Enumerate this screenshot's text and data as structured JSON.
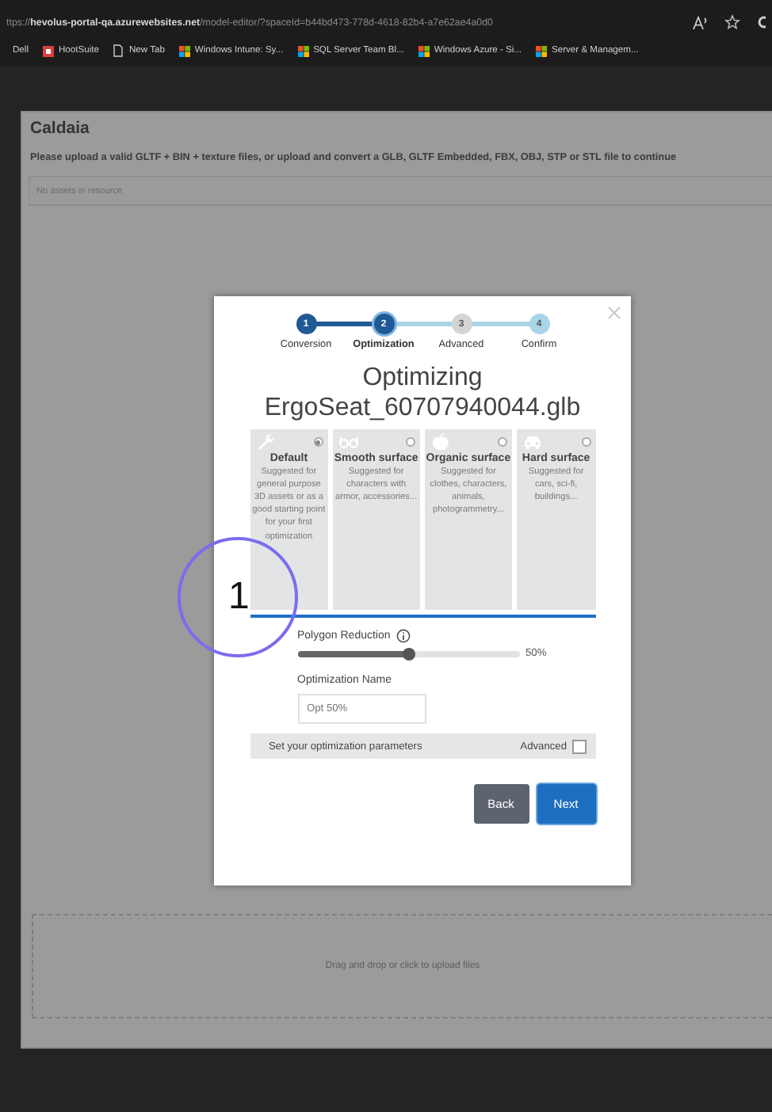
{
  "browser": {
    "url": "ttps://hevolus-portal-qa.azurewebsites.net/model-editor/?spaceId=b44bd473-778d-4618-82b4-a7e62ae4a0d0",
    "bookmarks": [
      "Dell",
      "HootSuite",
      "New Tab",
      "Windows Intune: Sy...",
      "SQL Server Team Bl...",
      "Windows Azure - Si...",
      "Server & Managem..."
    ]
  },
  "page": {
    "title": "Caldaia",
    "instruction": "Please upload a valid GLTF + BIN + texture files, or upload and convert a GLB, GLTF Embedded, FBX, OBJ, STP or STL file to continue",
    "assets_empty": "No assets in resource",
    "dropzone": "Drag and drop or click to upload files"
  },
  "dialog": {
    "steps": [
      {
        "number": "1",
        "label": "Conversion",
        "selected": false,
        "color": "#1f5a96"
      },
      {
        "number": "2",
        "label": "Optimization",
        "selected": true,
        "color": "#1f5a96"
      },
      {
        "number": "3",
        "label": "Advanced",
        "selected": false,
        "color": "#d4d4d4"
      },
      {
        "number": "4",
        "label": "Confirm",
        "selected": false,
        "color": "#a9d5e6"
      }
    ],
    "heading": "Optimizing",
    "filename": "ErgoSeat_60707940044.glb",
    "presets": [
      {
        "title": "Default",
        "description": "Suggested for general purpose 3D assets or as a good starting point for your first optimization",
        "selected": true
      },
      {
        "title": "Smooth surface",
        "description": "Suggested for characters with armor, accessories...",
        "selected": false
      },
      {
        "title": "Organic surface",
        "description": "Suggested for clothes, characters, animals, photogrammetry...",
        "selected": false
      },
      {
        "title": "Hard surface",
        "description": "Suggested for cars, sci-fi, buildings...",
        "selected": false
      }
    ],
    "polygon_reduction": {
      "label": "Polygon Reduction",
      "level": 0.5,
      "reading": "50%"
    },
    "optimization_name": {
      "label": "Optimization Name",
      "value": "Opt 50%"
    },
    "parameters": {
      "label": "Set your optimization parameters",
      "advanced_label": "Advanced",
      "checked": false
    },
    "buttons": [
      {
        "label": "Back",
        "kind": "secondary"
      },
      {
        "label": "Next",
        "kind": "primary"
      }
    ]
  },
  "annotation": {
    "label": "1"
  }
}
